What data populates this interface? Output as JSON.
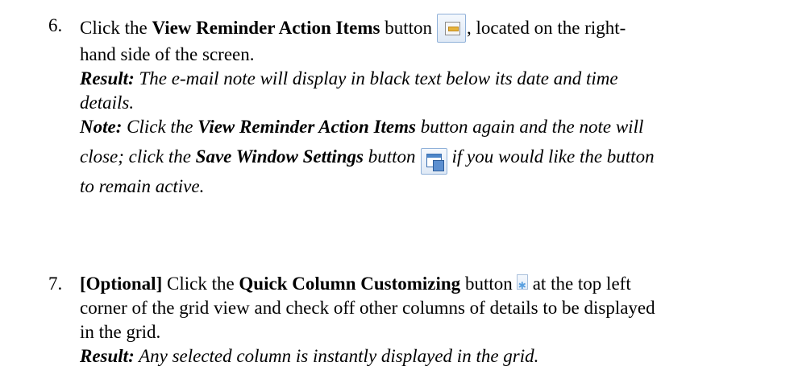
{
  "steps": [
    {
      "number": "6.",
      "line1": {
        "pre": "Click the ",
        "bold": "View Reminder Action Items",
        "mid": " button",
        "post": ", located on the right-"
      },
      "line2": "hand side of the screen.",
      "result": {
        "label": "Result:",
        "line1": " The e-mail note will display in black text below its date and time",
        "line2": "details."
      },
      "note": {
        "label": "Note:",
        "pre1": " Click the ",
        "bold1": "View Reminder Action Items",
        "post1": " button again and the note will",
        "pre2": "close; click the ",
        "bold2": "Save Window Settings",
        "mid2": " button",
        "post2": "if you would like the button",
        "line3": "to remain active."
      },
      "icons": [
        "view-reminder-action-items-icon",
        "save-window-settings-icon"
      ]
    },
    {
      "number": "7.",
      "line1": {
        "bold": "[Optional]",
        "pre": " Click the ",
        "bold2": "Quick Column Customizing",
        "mid": " button",
        "post": "at the top left"
      },
      "line2": "corner of the grid view and check off other columns of details to be displayed",
      "line3": "in the grid.",
      "result": {
        "label": "Result:",
        "text": " Any selected column is instantly displayed in the grid."
      },
      "icons": [
        "quick-column-customizing-icon"
      ]
    }
  ],
  "colors": {
    "text": "#000000",
    "icon_border": "#8fb0d8",
    "icon_bg": "#dfe9f6"
  }
}
